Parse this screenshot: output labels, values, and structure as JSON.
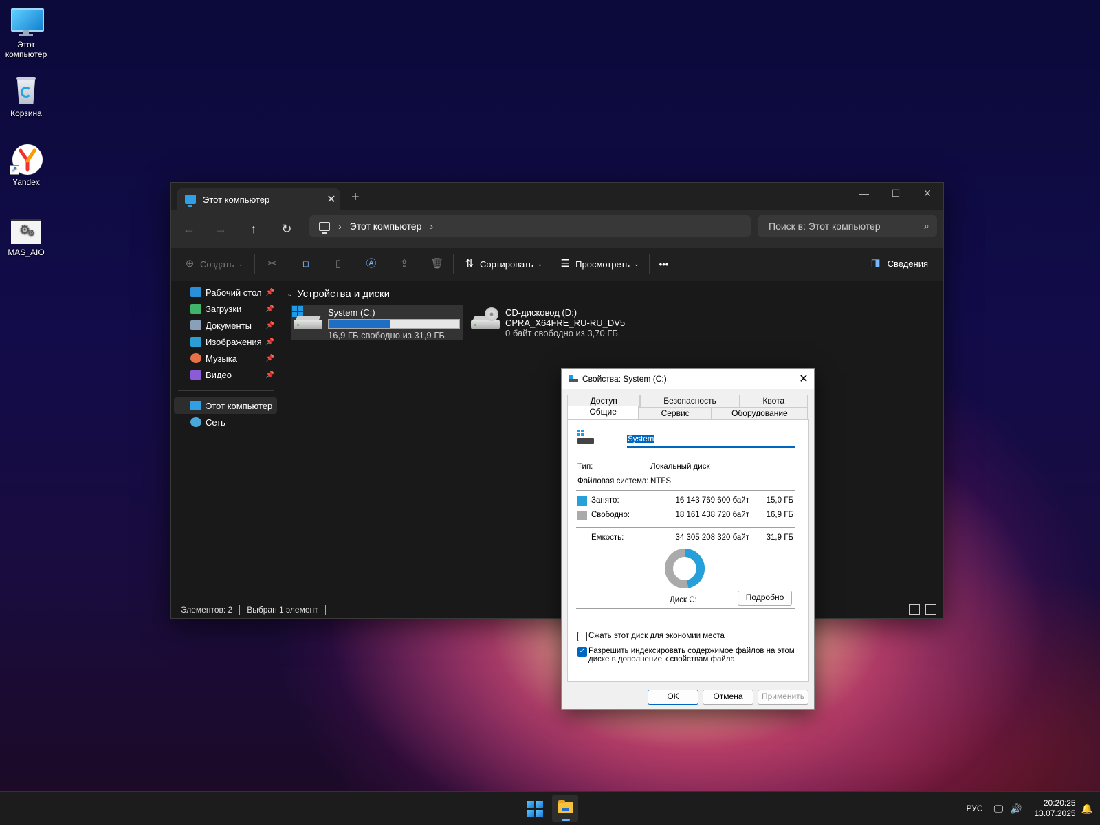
{
  "desktop": {
    "icons": [
      {
        "label1": "Этот",
        "label2": "компьютер"
      },
      {
        "label1": "Корзина"
      },
      {
        "label1": "Yandex"
      },
      {
        "label1": "MAS_AIO"
      }
    ]
  },
  "explorer": {
    "tab_title": "Этот компьютер",
    "address": "Этот компьютер",
    "search_placeholder": "Поиск в: Этот компьютер",
    "toolbar": {
      "create": "Создать",
      "sort": "Сортировать",
      "view": "Просмотреть",
      "more": "•••",
      "details": "Сведения"
    },
    "sidebar": {
      "quick": [
        {
          "label": "Рабочий стол",
          "color": "#2b8fd8"
        },
        {
          "label": "Загрузки",
          "color": "#3fb46a"
        },
        {
          "label": "Документы",
          "color": "#8aa0b8"
        },
        {
          "label": "Изображения",
          "color": "#2a9fd6"
        },
        {
          "label": "Музыка",
          "color": "#e8714a"
        },
        {
          "label": "Видео",
          "color": "#8b5cd6"
        }
      ],
      "this_pc": "Этот компьютер",
      "network": "Сеть"
    },
    "group_header": "Устройства и диски",
    "drives": [
      {
        "name": "System (C:)",
        "free_text": "16,9 ГБ свободно из 31,9 ГБ",
        "used_fraction": 0.47
      },
      {
        "name": "CD-дисковод (D:)",
        "label": "CPRA_X64FRE_RU-RU_DV5",
        "free_text": "0 байт свободно из 3,70 ГБ"
      }
    ],
    "status": {
      "items": "Элементов: 2",
      "selected": "Выбран 1 элемент"
    }
  },
  "dialog": {
    "title": "Свойства: System (C:)",
    "tabs_row1": [
      "Доступ",
      "Безопасность",
      "Квота"
    ],
    "tabs_row2": [
      "Общие",
      "Сервис",
      "Оборудование"
    ],
    "volume_name": "System",
    "type_label": "Тип:",
    "type_value": "Локальный диск",
    "fs_label": "Файловая система:",
    "fs_value": "NTFS",
    "used_label": "Занято:",
    "used_bytes": "16 143 769 600 байт",
    "used_gb": "15,0 ГБ",
    "free_label": "Свободно:",
    "free_bytes": "18 161 438 720 байт",
    "free_gb": "16,9 ГБ",
    "capacity_label": "Емкость:",
    "capacity_bytes": "34 305 208 320 байт",
    "capacity_gb": "31,9 ГБ",
    "used_color": "#26a0da",
    "free_color": "#aaaaaa",
    "used_fraction": 0.47,
    "disk_label": "Диск C:",
    "details_btn": "Подробно",
    "compress_label": "Сжать этот диск для экономии места",
    "compress_checked": false,
    "index_label_1": "Разрешить индексировать содержимое файлов на этом",
    "index_label_2": "диске в дополнение к свойствам файла",
    "index_checked": true,
    "ok": "OK",
    "cancel": "Отмена",
    "apply": "Применить"
  },
  "taskbar": {
    "lang": "РУС",
    "time": "20:20:25",
    "date": "13.07.2025"
  }
}
